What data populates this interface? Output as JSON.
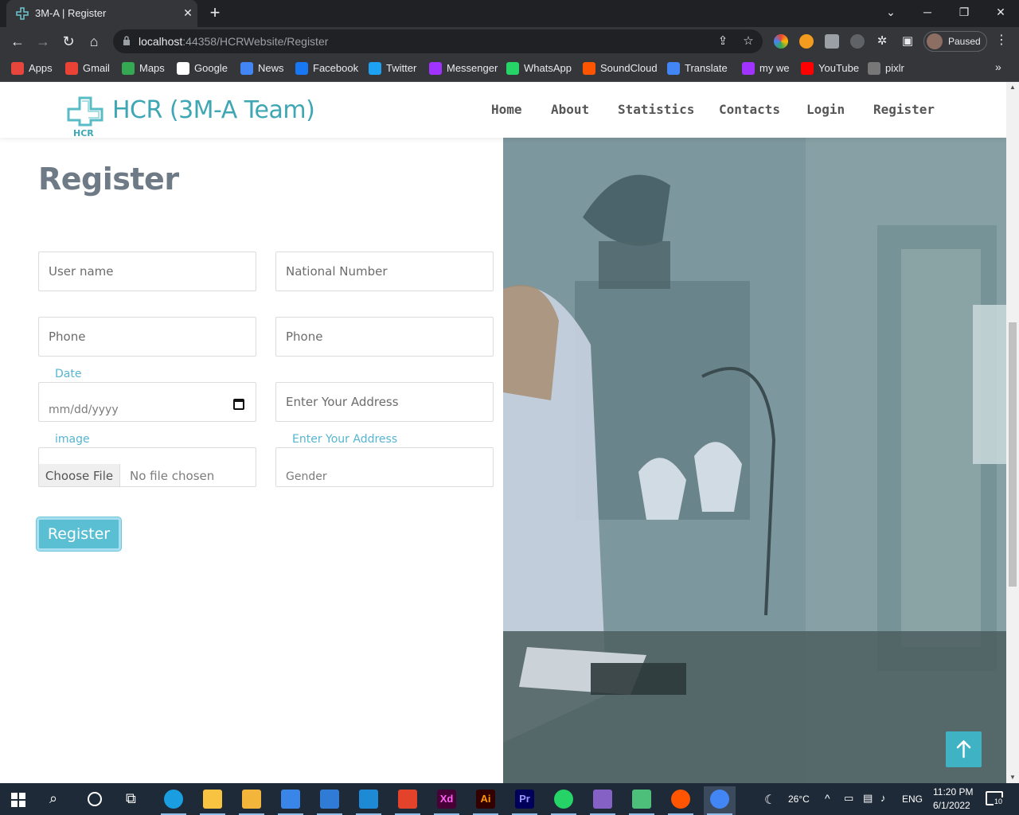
{
  "browser": {
    "tab_title": "3M-A | Register",
    "tab_close": "✕",
    "new_tab": "+",
    "window_controls": {
      "tabs_menu": "⌄",
      "minimize": "─",
      "restore": "❐",
      "close": "✕"
    },
    "url_host": "localhost",
    "url_path": ":44358/HCRWebsite/Register",
    "profile_status": "Paused",
    "bookmarks": [
      {
        "label": "Apps",
        "icon": "apps-grid-icon",
        "color": "#e8453c"
      },
      {
        "label": "Gmail",
        "icon": "gmail-icon",
        "color": "#ea4335"
      },
      {
        "label": "Maps",
        "icon": "maps-pin-icon",
        "color": "#34a853"
      },
      {
        "label": "Google",
        "icon": "google-icon",
        "color": "#ffffff"
      },
      {
        "label": "News",
        "icon": "news-icon",
        "color": "#4285f4"
      },
      {
        "label": "Facebook",
        "icon": "facebook-icon",
        "color": "#1877f2"
      },
      {
        "label": "Twitter",
        "icon": "twitter-icon",
        "color": "#1da1f2"
      },
      {
        "label": "Messenger",
        "icon": "messenger-icon",
        "color": "#a033ff"
      },
      {
        "label": "WhatsApp",
        "icon": "whatsapp-icon",
        "color": "#25d366"
      },
      {
        "label": "SoundCloud",
        "icon": "soundcloud-icon",
        "color": "#ff5500"
      },
      {
        "label": "Translate",
        "icon": "translate-icon",
        "color": "#4285f4"
      },
      {
        "label": "my we",
        "icon": "wand-icon",
        "color": "#a033ff"
      },
      {
        "label": "YouTube",
        "icon": "youtube-icon",
        "color": "#ff0000"
      },
      {
        "label": "pixlr",
        "icon": "pixlr-icon",
        "color": "#777777"
      }
    ],
    "bookmarks_more": "»"
  },
  "site": {
    "logo_text": "HCR (3M-A Team)",
    "logo_mark_text": "HCR",
    "nav": [
      "Home",
      "About",
      "Statistics",
      "Contacts",
      "Login",
      "Register"
    ],
    "accent_color": "#3fa7b4"
  },
  "form": {
    "title": "Register",
    "username_placeholder": "User name",
    "national_number_placeholder": "National Number",
    "phone_placeholder": "Phone",
    "phone2_placeholder": "Phone",
    "date_label": "Date",
    "date_placeholder": "mm/dd/yyyy",
    "address_placeholder": "Enter Your Address",
    "image_label": "image",
    "choose_file": "Choose File",
    "no_file": "No file chosen",
    "address_label": "Enter Your Address",
    "gender_placeholder": "Gender",
    "submit": "Register"
  },
  "taskbar": {
    "weather": "26°C",
    "language": "ENG",
    "time": "11:20 PM",
    "date": "6/1/2022",
    "notifications": "10",
    "apps": [
      {
        "name": "edge-icon",
        "color": "#1b9de2"
      },
      {
        "name": "file-explorer-icon",
        "color": "#f8c341"
      },
      {
        "name": "folder-icon",
        "color": "#f3b63a"
      },
      {
        "name": "store-icon",
        "color": "#3a86e8"
      },
      {
        "name": "mail-icon",
        "color": "#2f7bd6"
      },
      {
        "name": "vscode-icon",
        "color": "#1e8ad6"
      },
      {
        "name": "office-icon",
        "color": "#e2432a"
      },
      {
        "name": "adobe-xd-icon",
        "color": "#470137"
      },
      {
        "name": "illustrator-icon",
        "color": "#330000"
      },
      {
        "name": "premiere-icon",
        "color": "#00005b"
      },
      {
        "name": "whatsapp-icon",
        "color": "#25d366"
      },
      {
        "name": "visual-studio-icon",
        "color": "#8661c5"
      },
      {
        "name": "git-icon",
        "color": "#4dbf7a"
      },
      {
        "name": "soundcloud-icon",
        "color": "#ff5500"
      },
      {
        "name": "chrome-icon",
        "color": "#4285f4"
      }
    ],
    "app_labels": [
      "Xd",
      "Ai",
      "Pr"
    ]
  }
}
